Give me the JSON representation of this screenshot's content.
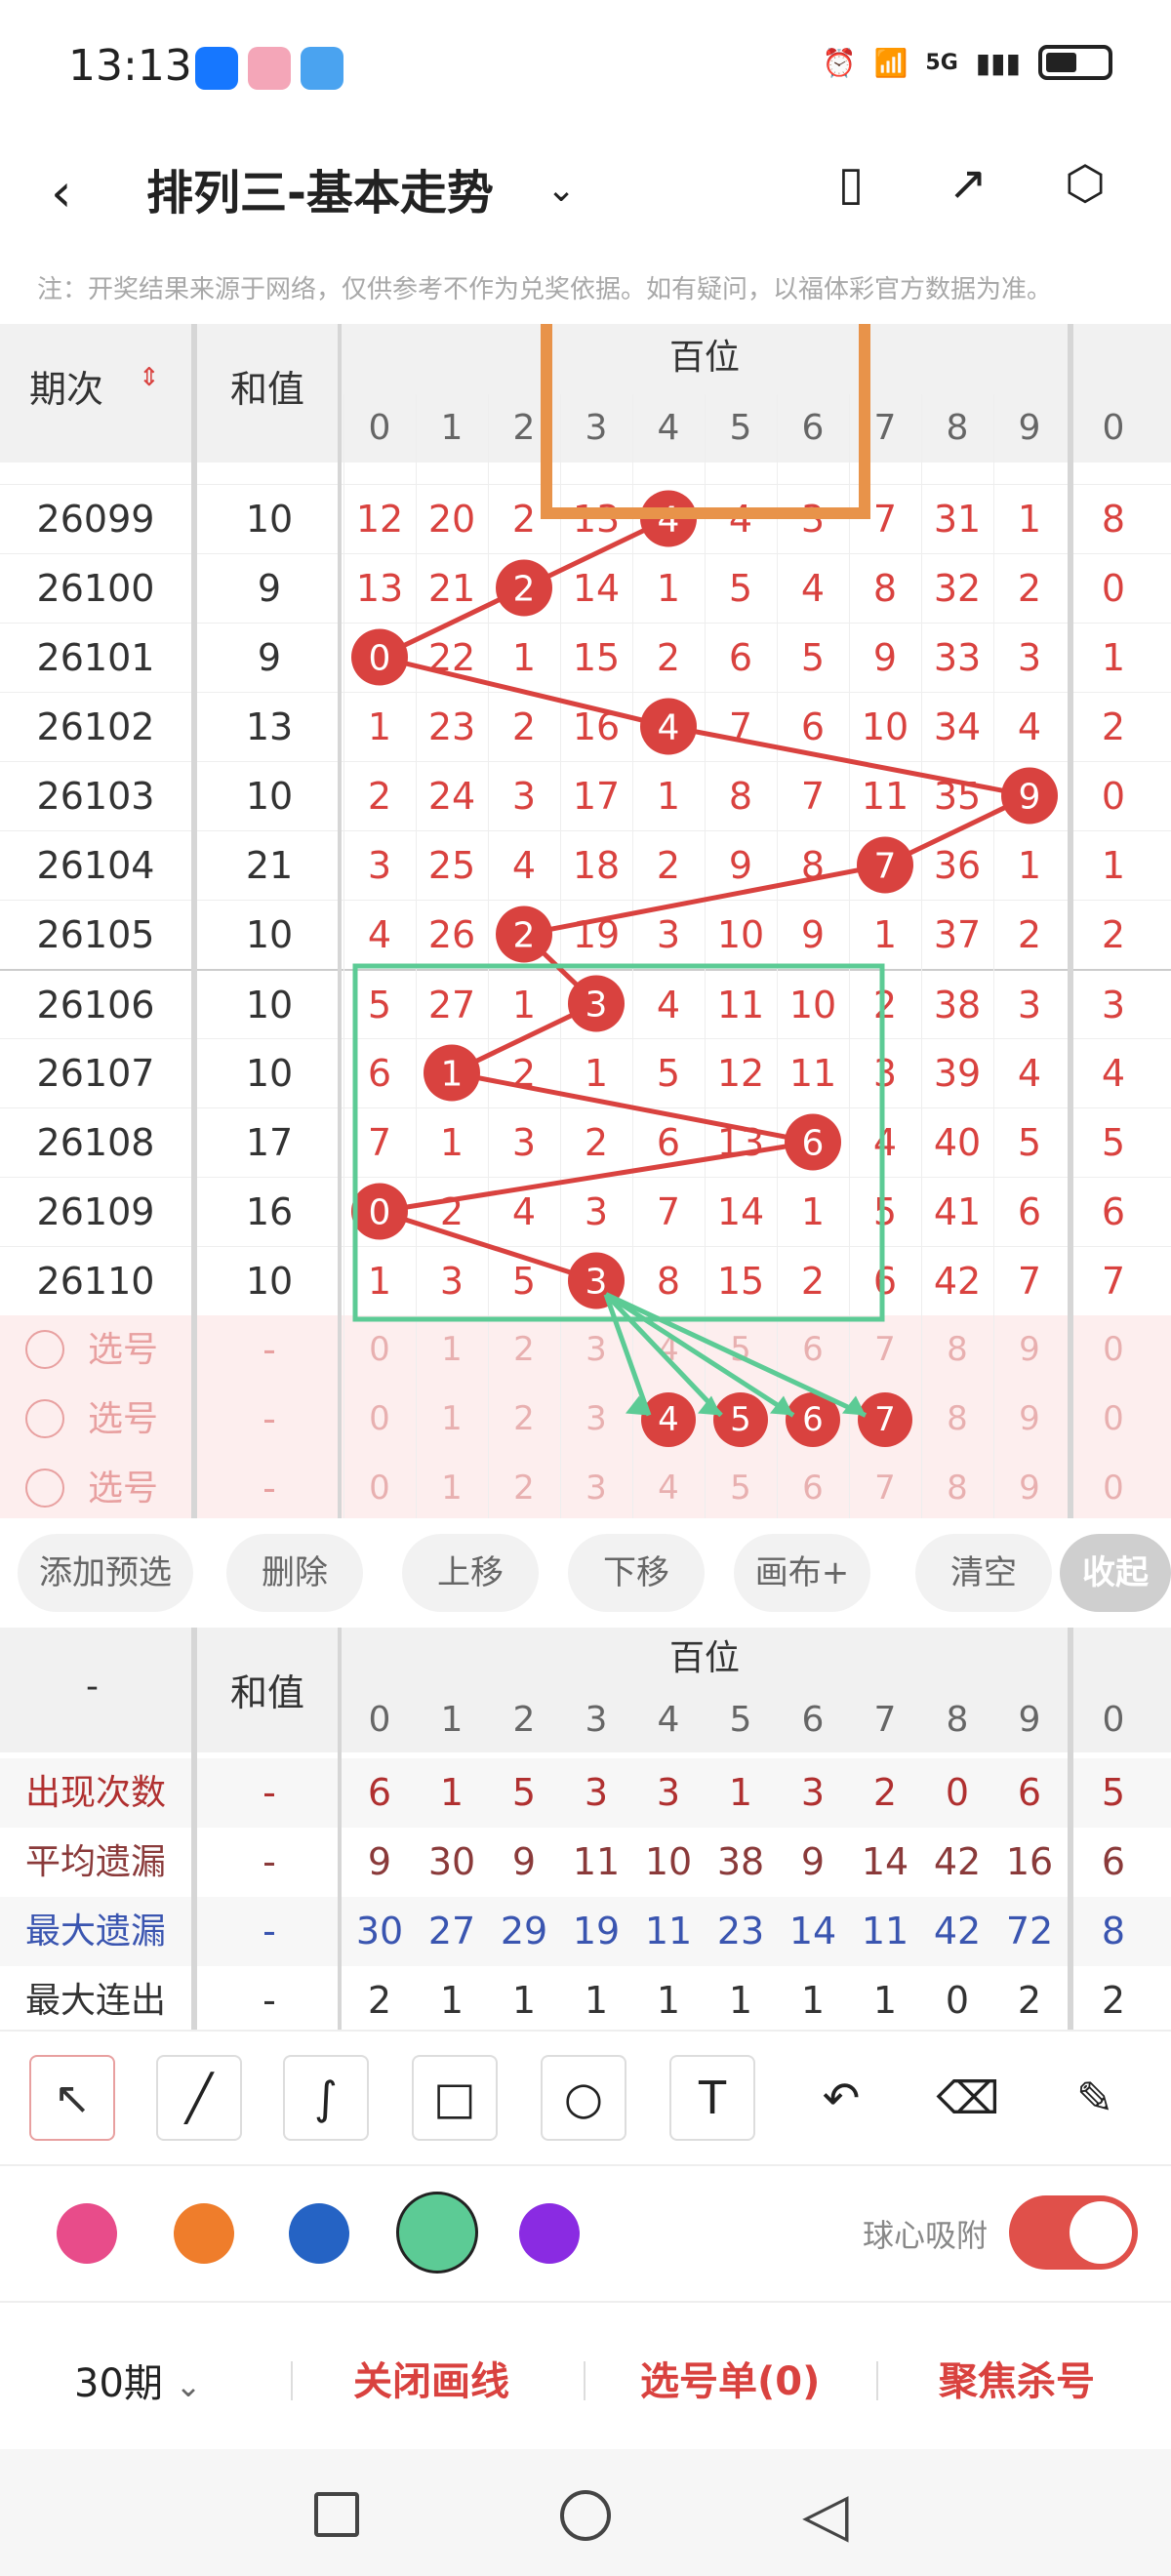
{
  "status": {
    "time": "13:13",
    "icons": [
      "alipay-icon",
      "app-icon",
      "weather-icon"
    ],
    "network": "5G"
  },
  "header": {
    "title": "排列三-基本走势"
  },
  "notice": "注：开奖结果来源于网络，仅供参考不作为兑奖依据。如有疑问，以福体彩官方数据为准。",
  "table": {
    "col_period": "期次",
    "col_sum": "和值",
    "group": "百位",
    "digits": [
      "0",
      "1",
      "2",
      "3",
      "4",
      "5",
      "6",
      "7",
      "8",
      "9"
    ],
    "extra_digit": "0",
    "rows": [
      {
        "period": "26099",
        "sum": "10",
        "hit": 4,
        "vals": [
          "12",
          "20",
          "2",
          "13",
          "4",
          "4",
          "3",
          "7",
          "31",
          "1"
        ],
        "extra": "8"
      },
      {
        "period": "26100",
        "sum": "9",
        "hit": 2,
        "vals": [
          "13",
          "21",
          "2",
          "14",
          "1",
          "5",
          "4",
          "8",
          "32",
          "2"
        ],
        "extra": "0"
      },
      {
        "period": "26101",
        "sum": "9",
        "hit": 0,
        "vals": [
          "0",
          "22",
          "1",
          "15",
          "2",
          "6",
          "5",
          "9",
          "33",
          "3"
        ],
        "extra": "1"
      },
      {
        "period": "26102",
        "sum": "13",
        "hit": 4,
        "vals": [
          "1",
          "23",
          "2",
          "16",
          "4",
          "7",
          "6",
          "10",
          "34",
          "4"
        ],
        "extra": "2"
      },
      {
        "period": "26103",
        "sum": "10",
        "hit": 9,
        "vals": [
          "2",
          "24",
          "3",
          "17",
          "1",
          "8",
          "7",
          "11",
          "35",
          "9"
        ],
        "extra": "0"
      },
      {
        "period": "26104",
        "sum": "21",
        "hit": 7,
        "vals": [
          "3",
          "25",
          "4",
          "18",
          "2",
          "9",
          "8",
          "7",
          "36",
          "1"
        ],
        "extra": "1"
      },
      {
        "period": "26105",
        "sum": "10",
        "hit": 2,
        "vals": [
          "4",
          "26",
          "2",
          "19",
          "3",
          "10",
          "9",
          "1",
          "37",
          "2"
        ],
        "extra": "2"
      },
      {
        "period": "26106",
        "sum": "10",
        "hit": 3,
        "vals": [
          "5",
          "27",
          "1",
          "3",
          "4",
          "11",
          "10",
          "2",
          "38",
          "3"
        ],
        "extra": "3"
      },
      {
        "period": "26107",
        "sum": "10",
        "hit": 1,
        "vals": [
          "6",
          "1",
          "2",
          "1",
          "5",
          "12",
          "11",
          "3",
          "39",
          "4"
        ],
        "extra": "4"
      },
      {
        "period": "26108",
        "sum": "17",
        "hit": 6,
        "vals": [
          "7",
          "1",
          "3",
          "2",
          "6",
          "13",
          "6",
          "4",
          "40",
          "5"
        ],
        "extra": "5"
      },
      {
        "period": "26109",
        "sum": "16",
        "hit": 0,
        "vals": [
          "0",
          "2",
          "4",
          "3",
          "7",
          "14",
          "1",
          "5",
          "41",
          "6"
        ],
        "extra": "6"
      },
      {
        "period": "26110",
        "sum": "10",
        "hit": 3,
        "vals": [
          "1",
          "3",
          "5",
          "3",
          "8",
          "15",
          "2",
          "6",
          "42",
          "7"
        ],
        "extra": "7"
      }
    ],
    "select_rows": [
      {
        "label": "选号",
        "sum": "-",
        "picked": []
      },
      {
        "label": "选号",
        "sum": "-",
        "picked": [
          4,
          5,
          6,
          7
        ]
      },
      {
        "label": "选号",
        "sum": "-",
        "picked": []
      }
    ]
  },
  "actions": [
    "添加预选",
    "删除",
    "上移",
    "下移",
    "画布+",
    "清空",
    "收起"
  ],
  "stats": {
    "col_first": "-",
    "col_sum": "和值",
    "group": "百位",
    "rows": [
      {
        "label": "出现次数",
        "sum": "-",
        "color": "#b03030",
        "vals": [
          "6",
          "1",
          "5",
          "3",
          "3",
          "1",
          "3",
          "2",
          "0",
          "6"
        ],
        "extra": "5"
      },
      {
        "label": "平均遗漏",
        "sum": "-",
        "color": "#8a3a3a",
        "vals": [
          "9",
          "30",
          "9",
          "11",
          "10",
          "38",
          "9",
          "14",
          "42",
          "16"
        ],
        "extra": "6"
      },
      {
        "label": "最大遗漏",
        "sum": "-",
        "color": "#3a55b0",
        "vals": [
          "30",
          "27",
          "29",
          "19",
          "11",
          "23",
          "14",
          "11",
          "42",
          "72"
        ],
        "extra": "8"
      },
      {
        "label": "最大连出",
        "sum": "-",
        "color": "#333",
        "vals": [
          "2",
          "1",
          "1",
          "1",
          "1",
          "1",
          "1",
          "1",
          "0",
          "2"
        ],
        "extra": "2"
      }
    ]
  },
  "tools": [
    "select-arrow-icon",
    "line-icon",
    "freehand-icon",
    "rectangle-icon",
    "circle-icon",
    "text-icon",
    "undo-icon",
    "eraser-icon",
    "clear-brush-icon"
  ],
  "palette": {
    "colors": [
      "#e84c8a",
      "#ef7d2b",
      "#2563c4",
      "#5ccb95",
      "#8a2be2"
    ],
    "selected": 3,
    "snap_label": "球心吸附",
    "snap_on": true
  },
  "bottom": {
    "period_select": "30期",
    "close_lines": "关闭画线",
    "pick_list": "选号单(0)",
    "focus_kill": "聚焦杀号"
  },
  "colors": {
    "ball": "#d9423f",
    "accent": "#d9423f",
    "muted": "#e8a0a0",
    "orange": "#e8934a",
    "green": "#5ccb95"
  }
}
